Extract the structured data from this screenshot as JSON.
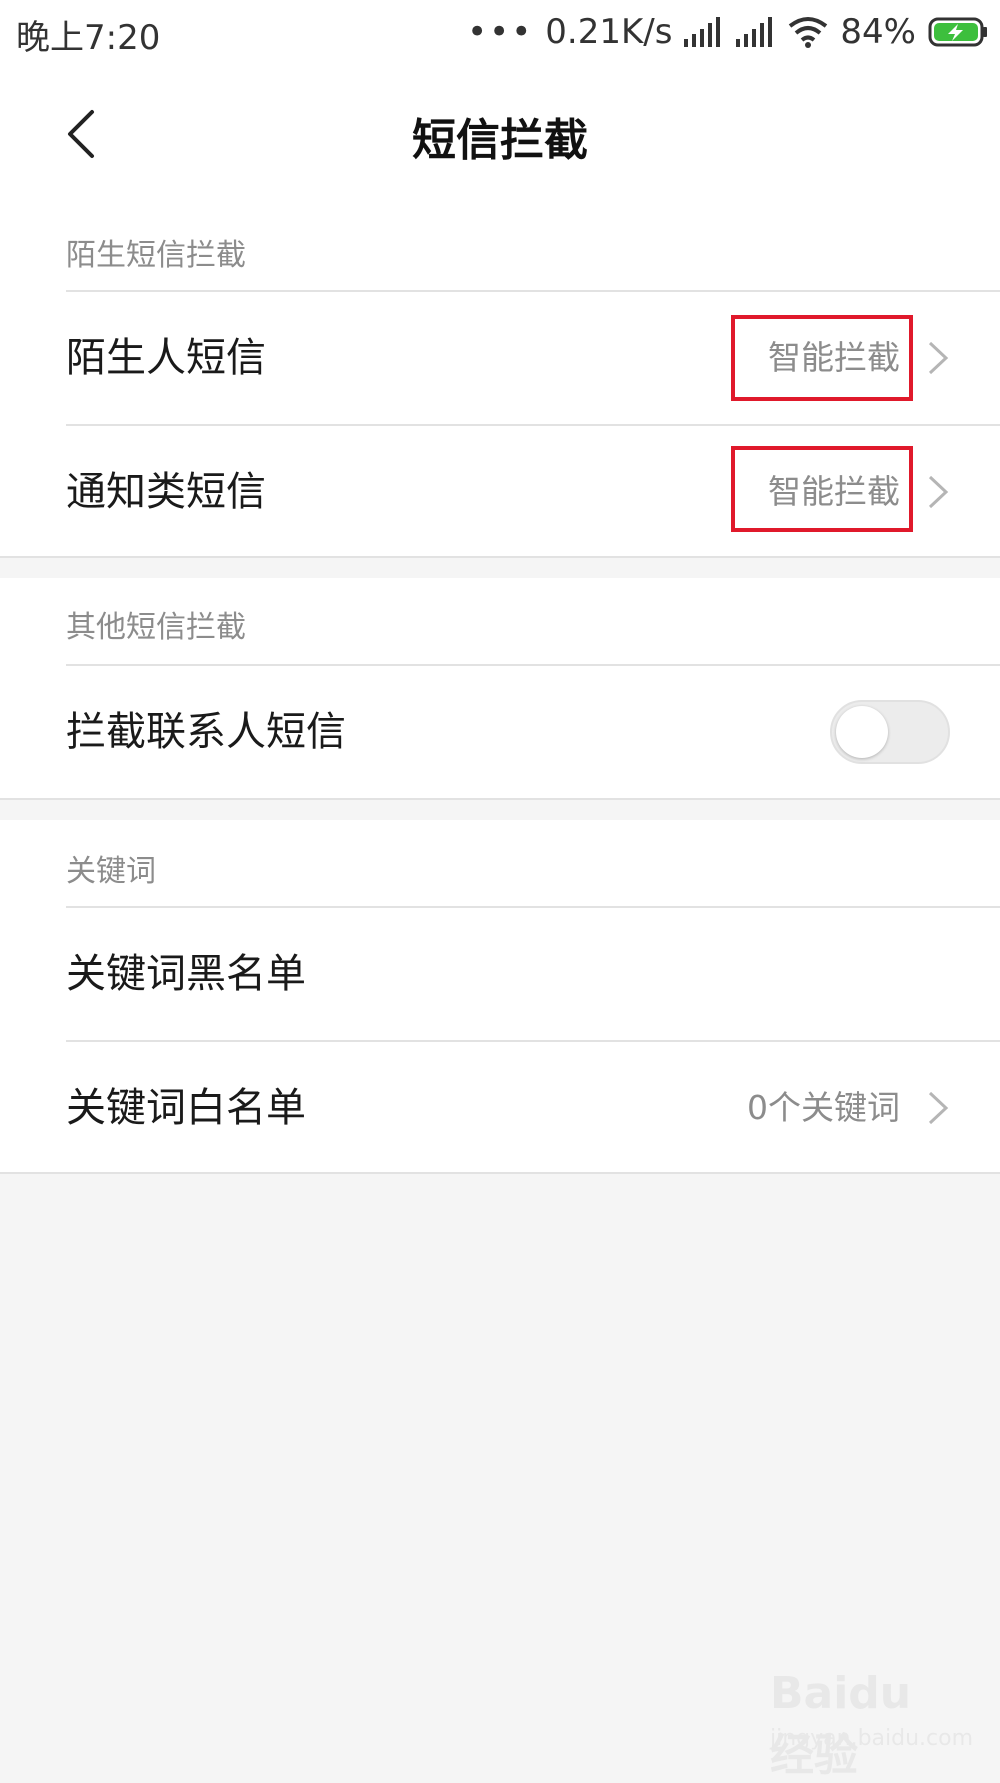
{
  "status_bar": {
    "time": "晚上7:20",
    "dots": "•••",
    "net_speed": "0.21K/s",
    "battery": "84%"
  },
  "header": {
    "title": "短信拦截",
    "back_icon": "chevron-left-icon"
  },
  "sections": {
    "stranger": {
      "title": "陌生短信拦截",
      "rows": [
        {
          "label": "陌生人短信",
          "value": "智能拦截"
        },
        {
          "label": "通知类短信",
          "value": "智能拦截"
        }
      ]
    },
    "other": {
      "title": "其他短信拦截",
      "rows": [
        {
          "label": "拦截联系人短信",
          "toggle_on": false
        }
      ]
    },
    "keywords": {
      "title": "关键词",
      "rows": [
        {
          "label": "关键词黑名单"
        },
        {
          "label": "关键词白名单",
          "value": "0个关键词"
        }
      ]
    }
  },
  "watermark": {
    "main": "Baidu 经验",
    "sub": "jingyan.baidu.com"
  },
  "colors": {
    "highlight": "#e0192b",
    "battery": "#3dbf3d",
    "background": "#f5f5f5"
  }
}
